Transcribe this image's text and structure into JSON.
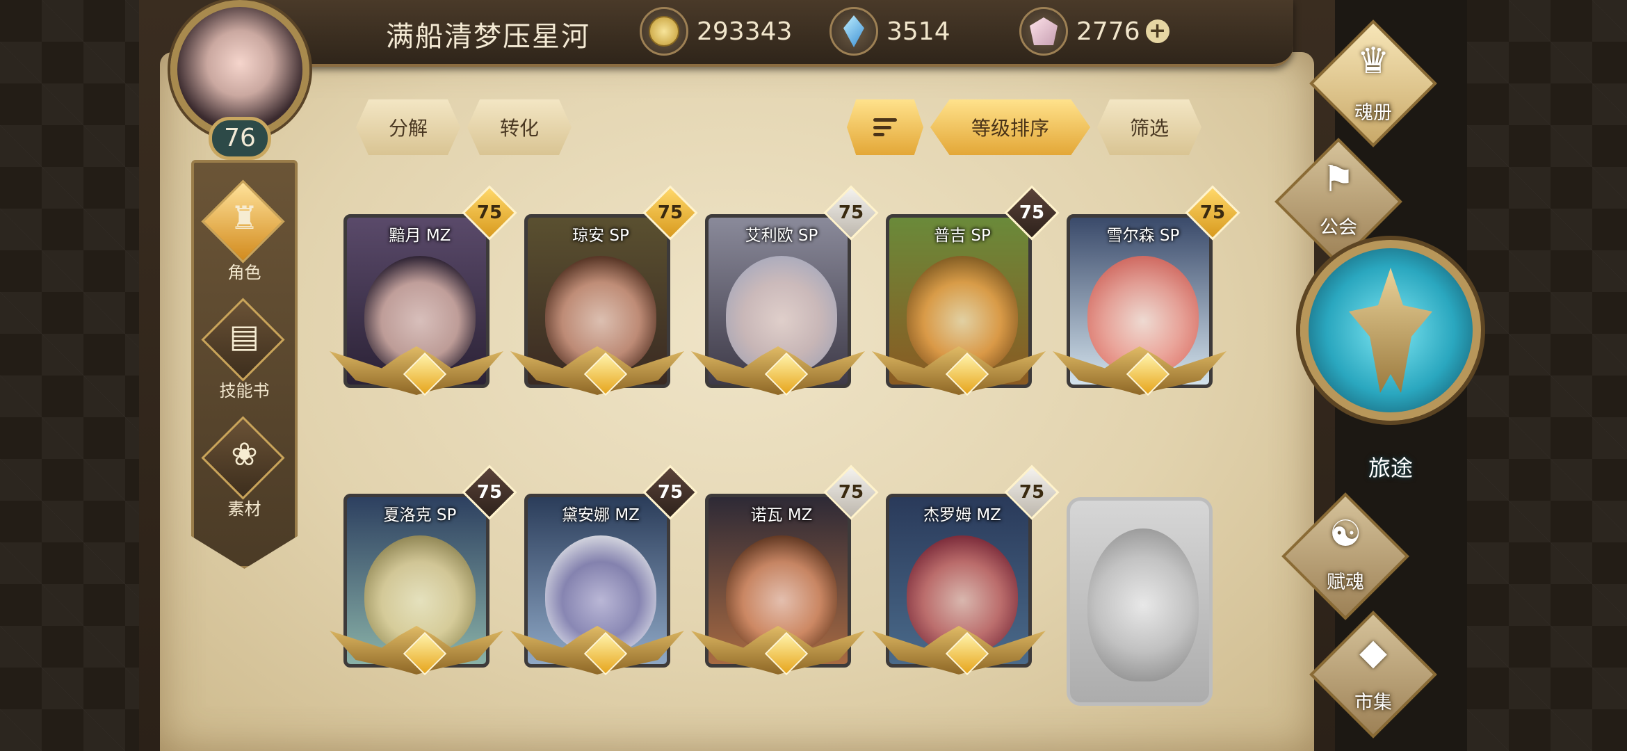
{
  "player": {
    "name": "满船清梦压星河",
    "level": "76"
  },
  "currencies": [
    {
      "id": "gold",
      "value": "293343",
      "icon": "gold-coin-icon"
    },
    {
      "id": "crystal",
      "value": "3514",
      "icon": "blue-crystal-icon"
    },
    {
      "id": "gem",
      "value": "2776",
      "icon": "pink-gem-icon",
      "add": "+"
    }
  ],
  "left_nav": [
    {
      "label": "角色",
      "icon": "character-helmet-icon",
      "glyph": "♜",
      "active": true
    },
    {
      "label": "技能书",
      "icon": "skill-book-icon",
      "glyph": "▤",
      "active": false
    },
    {
      "label": "素材",
      "icon": "material-beast-icon",
      "glyph": "❀",
      "active": false
    }
  ],
  "actions": {
    "decompose": "分解",
    "convert": "转化",
    "sort_by_level": "等级排序",
    "filter": "筛选"
  },
  "cards": [
    {
      "name": "黯月 MZ",
      "level": "75",
      "badge": "gold",
      "face": "#7a5a8a"
    },
    {
      "name": "琼安 SP",
      "level": "75",
      "badge": "gold",
      "face": "#b0605a"
    },
    {
      "name": "艾利欧 SP",
      "level": "75",
      "badge": "silver",
      "face": "#c9c8d6"
    },
    {
      "name": "普吉 SP",
      "level": "75",
      "badge": "dark",
      "face": "#e8a24a"
    },
    {
      "name": "雪尔森 SP",
      "level": "75",
      "badge": "gold",
      "face": "#f19a8e"
    },
    {
      "name": "夏洛克 SP",
      "level": "75",
      "badge": "dark",
      "face": "#f1e3ae"
    },
    {
      "name": "黛安娜 MZ",
      "level": "75",
      "badge": "dark",
      "face": "#8a86b3"
    },
    {
      "name": "诺瓦 MZ",
      "level": "75",
      "badge": "silver",
      "face": "#c3865a"
    },
    {
      "name": "杰罗姆 MZ",
      "level": "75",
      "badge": "silver",
      "face": "#c3525a"
    }
  ],
  "right_nav": [
    {
      "label": "魂册",
      "icon": "soul-album-icon",
      "glyph": "♛"
    },
    {
      "label": "公会",
      "icon": "guild-banner-icon",
      "glyph": "⚑"
    },
    {
      "label": "旅途",
      "icon": "journey-emblem-icon"
    },
    {
      "label": "赋魂",
      "icon": "soul-flame-icon",
      "glyph": "☯"
    },
    {
      "label": "市集",
      "icon": "market-gem-icon",
      "glyph": "◆"
    }
  ]
}
